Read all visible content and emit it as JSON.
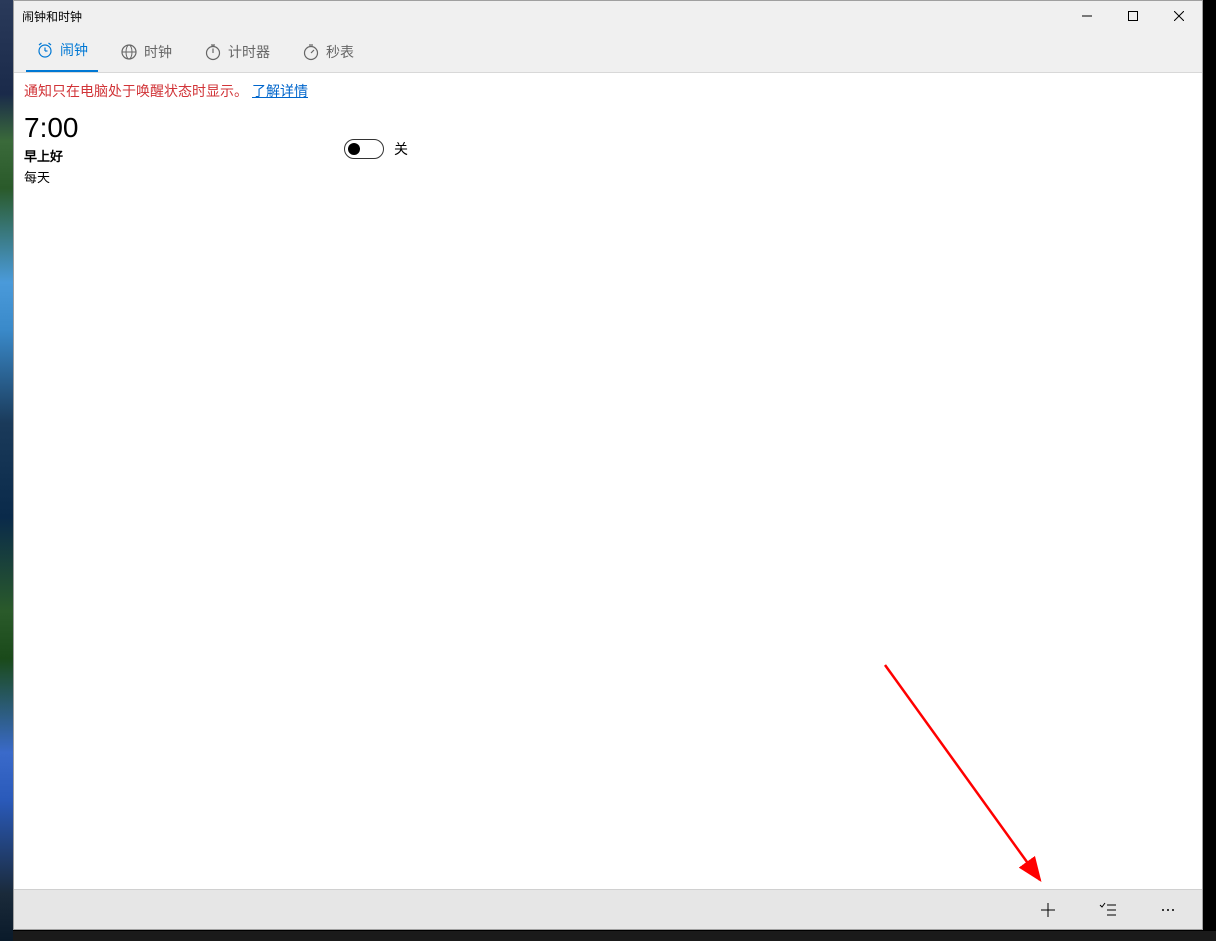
{
  "window": {
    "title": "闹钟和时钟"
  },
  "tabs": [
    {
      "label": "闹钟",
      "icon": "alarm-icon",
      "active": true
    },
    {
      "label": "时钟",
      "icon": "clock-icon",
      "active": false
    },
    {
      "label": "计时器",
      "icon": "timer-icon",
      "active": false
    },
    {
      "label": "秒表",
      "icon": "stopwatch-icon",
      "active": false
    }
  ],
  "notice": {
    "text": "通知只在电脑处于唤醒状态时显示。",
    "link_text": "了解详情"
  },
  "alarms": [
    {
      "time": "7:00",
      "name": "早上好",
      "repeat": "每天",
      "enabled": false,
      "toggle_label": "关"
    }
  ],
  "bottombar": {
    "add_label": "+",
    "select_label": "select",
    "more_label": "…"
  }
}
